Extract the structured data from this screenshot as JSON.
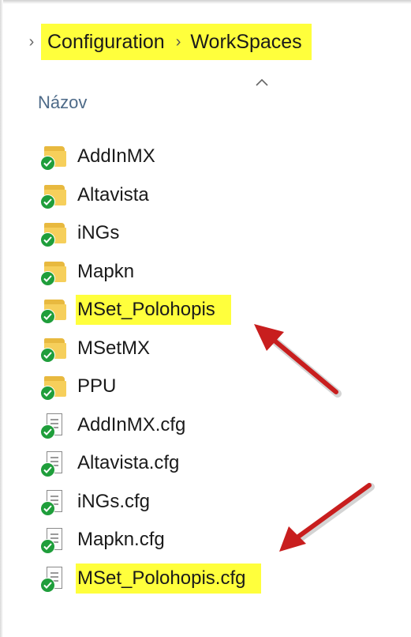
{
  "breadcrumb": {
    "items": [
      {
        "label": "Configuration"
      },
      {
        "label": "WorkSpaces"
      }
    ]
  },
  "header": {
    "column_name": "Názov"
  },
  "files": [
    {
      "name": "AddInMX",
      "type": "folder",
      "highlighted": false
    },
    {
      "name": "Altavista",
      "type": "folder",
      "highlighted": false
    },
    {
      "name": "iNGs",
      "type": "folder",
      "highlighted": false
    },
    {
      "name": "Mapkn",
      "type": "folder",
      "highlighted": false
    },
    {
      "name": "MSet_Polohopis",
      "type": "folder",
      "highlighted": true
    },
    {
      "name": "MSetMX",
      "type": "folder",
      "highlighted": false
    },
    {
      "name": "PPU",
      "type": "folder",
      "highlighted": false
    },
    {
      "name": "AddInMX.cfg",
      "type": "file",
      "highlighted": false
    },
    {
      "name": "Altavista.cfg",
      "type": "file",
      "highlighted": false
    },
    {
      "name": "iNGs.cfg",
      "type": "file",
      "highlighted": false
    },
    {
      "name": "Mapkn.cfg",
      "type": "file",
      "highlighted": false
    },
    {
      "name": "MSet_Polohopis.cfg",
      "type": "file",
      "highlighted": true
    }
  ],
  "colors": {
    "highlight": "#ffff3c",
    "sync_status": "#1f9e3b",
    "annotation_arrow": "#c81e1e",
    "header_text": "#4d6a88"
  },
  "icons": {
    "folder": "folder-icon",
    "file": "file-icon",
    "status": "synced-check-icon"
  }
}
